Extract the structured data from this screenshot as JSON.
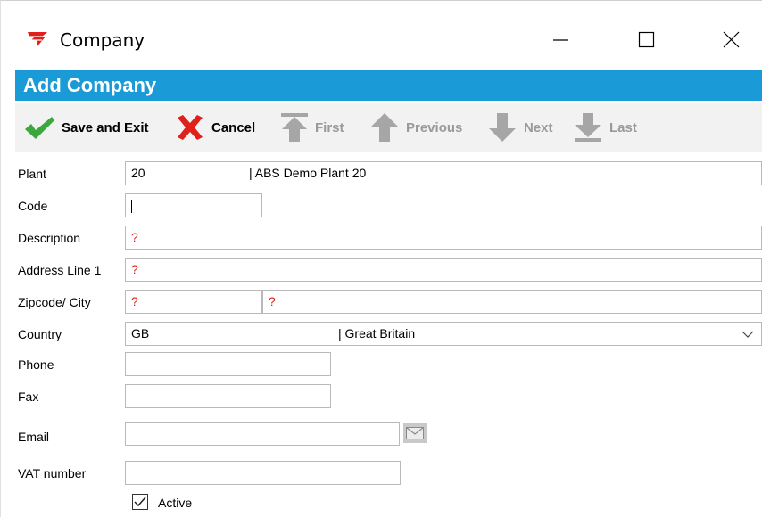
{
  "window": {
    "title": "Company",
    "icon": "red-arrow-logo-icon"
  },
  "header": {
    "title": "Add Company",
    "color": "#1a9ad6"
  },
  "toolbar": {
    "save_label": "Save and Exit",
    "cancel_label": "Cancel",
    "first_label": "First",
    "previous_label": "Previous",
    "next_label": "Next",
    "last_label": "Last"
  },
  "form": {
    "plant": {
      "label": "Plant",
      "code": "20",
      "name": "| ABS Demo Plant 20"
    },
    "code": {
      "label": "Code",
      "value": ""
    },
    "description": {
      "label": "Description",
      "value": "?"
    },
    "address1": {
      "label": "Address Line 1",
      "value": "?"
    },
    "zipcity": {
      "label": "Zipcode/ City",
      "zip": "?",
      "city": "?"
    },
    "country": {
      "label": "Country",
      "code": "GB",
      "name": "| Great Britain"
    },
    "phone": {
      "label": "Phone",
      "value": ""
    },
    "fax": {
      "label": "Fax",
      "value": ""
    },
    "email": {
      "label": "Email",
      "value": ""
    },
    "vat": {
      "label": "VAT number",
      "value": ""
    },
    "active": {
      "label": "Active",
      "checked": true
    }
  }
}
